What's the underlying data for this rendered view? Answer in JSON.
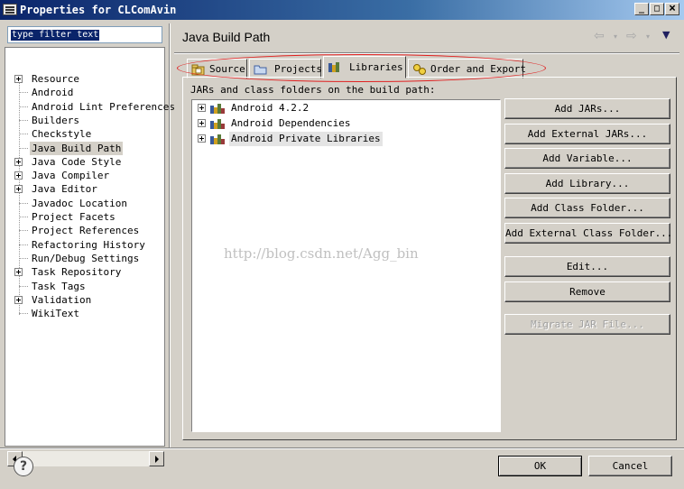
{
  "window": {
    "title": "Properties for CLComAvin",
    "minimize": "_",
    "maximize": "□",
    "close": "×"
  },
  "filter": {
    "value": "type filter text"
  },
  "nav": {
    "items": [
      {
        "label": "Resource",
        "expandable": true
      },
      {
        "label": "Android",
        "expandable": false
      },
      {
        "label": "Android Lint Preferences",
        "expandable": false
      },
      {
        "label": "Builders",
        "expandable": false
      },
      {
        "label": "Checkstyle",
        "expandable": false
      },
      {
        "label": "Java Build Path",
        "expandable": false,
        "selected": true
      },
      {
        "label": "Java Code Style",
        "expandable": true
      },
      {
        "label": "Java Compiler",
        "expandable": true
      },
      {
        "label": "Java Editor",
        "expandable": true
      },
      {
        "label": "Javadoc Location",
        "expandable": false
      },
      {
        "label": "Project Facets",
        "expandable": false
      },
      {
        "label": "Project References",
        "expandable": false
      },
      {
        "label": "Refactoring History",
        "expandable": false
      },
      {
        "label": "Run/Debug Settings",
        "expandable": false
      },
      {
        "label": "Task Repository",
        "expandable": true
      },
      {
        "label": "Task Tags",
        "expandable": false
      },
      {
        "label": "Validation",
        "expandable": true
      },
      {
        "label": "WikiText",
        "expandable": false
      }
    ]
  },
  "page": {
    "title": "Java Build Path",
    "nav_back": "⇦",
    "nav_forward": "⇨",
    "nav_dropdown": "▾",
    "view_menu": "▼"
  },
  "tabs": [
    {
      "label": "Source",
      "icon": "source-folder-icon"
    },
    {
      "label": "Projects",
      "icon": "projects-folder-icon"
    },
    {
      "label": "Libraries",
      "icon": "libraries-icon",
      "active": true
    },
    {
      "label": "Order and Export",
      "icon": "order-export-icon"
    }
  ],
  "libraries": {
    "section_label": "JARs and class folders on the build path:",
    "items": [
      {
        "label": "Android 4.2.2"
      },
      {
        "label": "Android Dependencies"
      },
      {
        "label": "Android Private Libraries",
        "selected": true
      }
    ]
  },
  "buttons": {
    "add_jars": "Add JARs...",
    "add_external_jars": "Add External JARs...",
    "add_variable": "Add Variable...",
    "add_library": "Add Library...",
    "add_class_folder": "Add Class Folder...",
    "add_external_class_folder": "Add External Class Folder...",
    "edit": "Edit...",
    "remove": "Remove",
    "migrate_jar": "Migrate JAR File..."
  },
  "watermark": "http://blog.csdn.net/Agg_bin",
  "footer": {
    "help": "?",
    "ok": "OK",
    "cancel": "Cancel"
  },
  "colors": {
    "dialog_bg": "#d4d0c8",
    "title_gradient_start": "#0a246a",
    "annotation": "#e02020"
  }
}
